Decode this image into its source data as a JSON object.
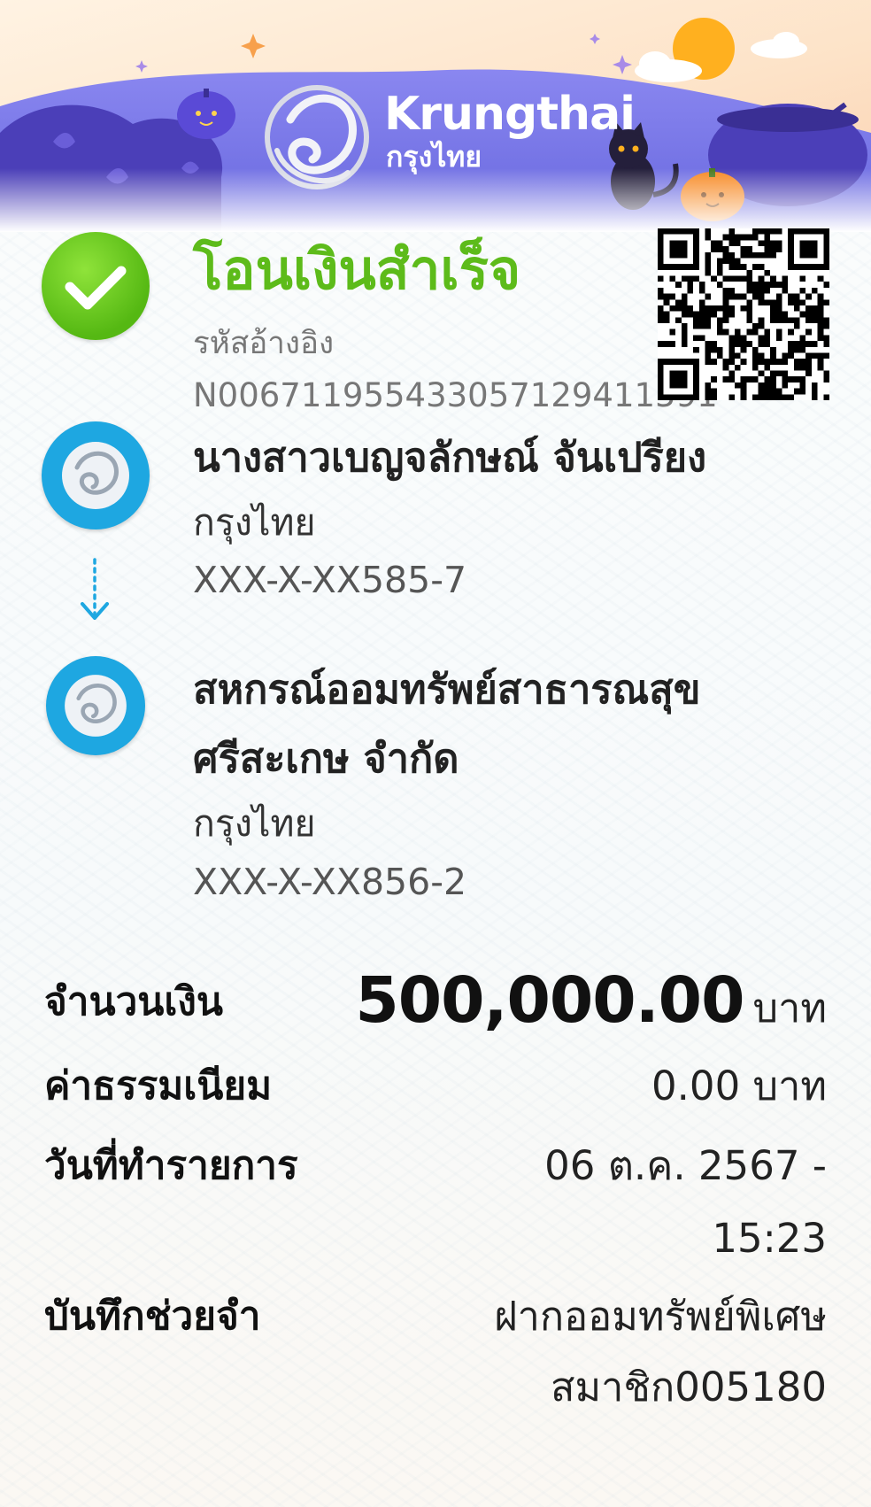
{
  "brand": {
    "name_en": "Krungthai",
    "name_th": "กรุงไทย"
  },
  "status": {
    "title": "โอนเงินสำเร็จ",
    "icon": "check-circle-icon",
    "color": "#5dbb1a"
  },
  "reference": {
    "label": "รหัสอ้างอิง",
    "value": "N006711955433057129411591"
  },
  "sender": {
    "name": "นางสาวเบญจลักษณ์ จันเปรียง",
    "bank": "กรุงไทย",
    "account": "XXX-X-XX585-7"
  },
  "receiver": {
    "name_line1": "สหกรณ์ออมทรัพย์สาธารณสุข",
    "name_line2": "ศรีสะเกษ จำกัด",
    "bank": "กรุงไทย",
    "account": "XXX-X-XX856-2"
  },
  "details": {
    "amount_label": "จำนวนเงิน",
    "amount_value": "500,000.00",
    "amount_unit": "บาท",
    "fee_label": "ค่าธรรมเนียม",
    "fee_value": "0.00 บาท",
    "date_label": "วันที่ทำรายการ",
    "date_value_line1": "06 ต.ค. 2567 -",
    "date_value_line2": "15:23",
    "memo_label": "บันทึกช่วยจำ",
    "memo_value_line1": "ฝากออมทรัพย์พิเศษ",
    "memo_value_line2": "สมาชิก005180"
  },
  "colors": {
    "brand_blue": "#1ea7e1",
    "banner_purple": "#6e6fe6",
    "success_green": "#5dbb1a"
  }
}
